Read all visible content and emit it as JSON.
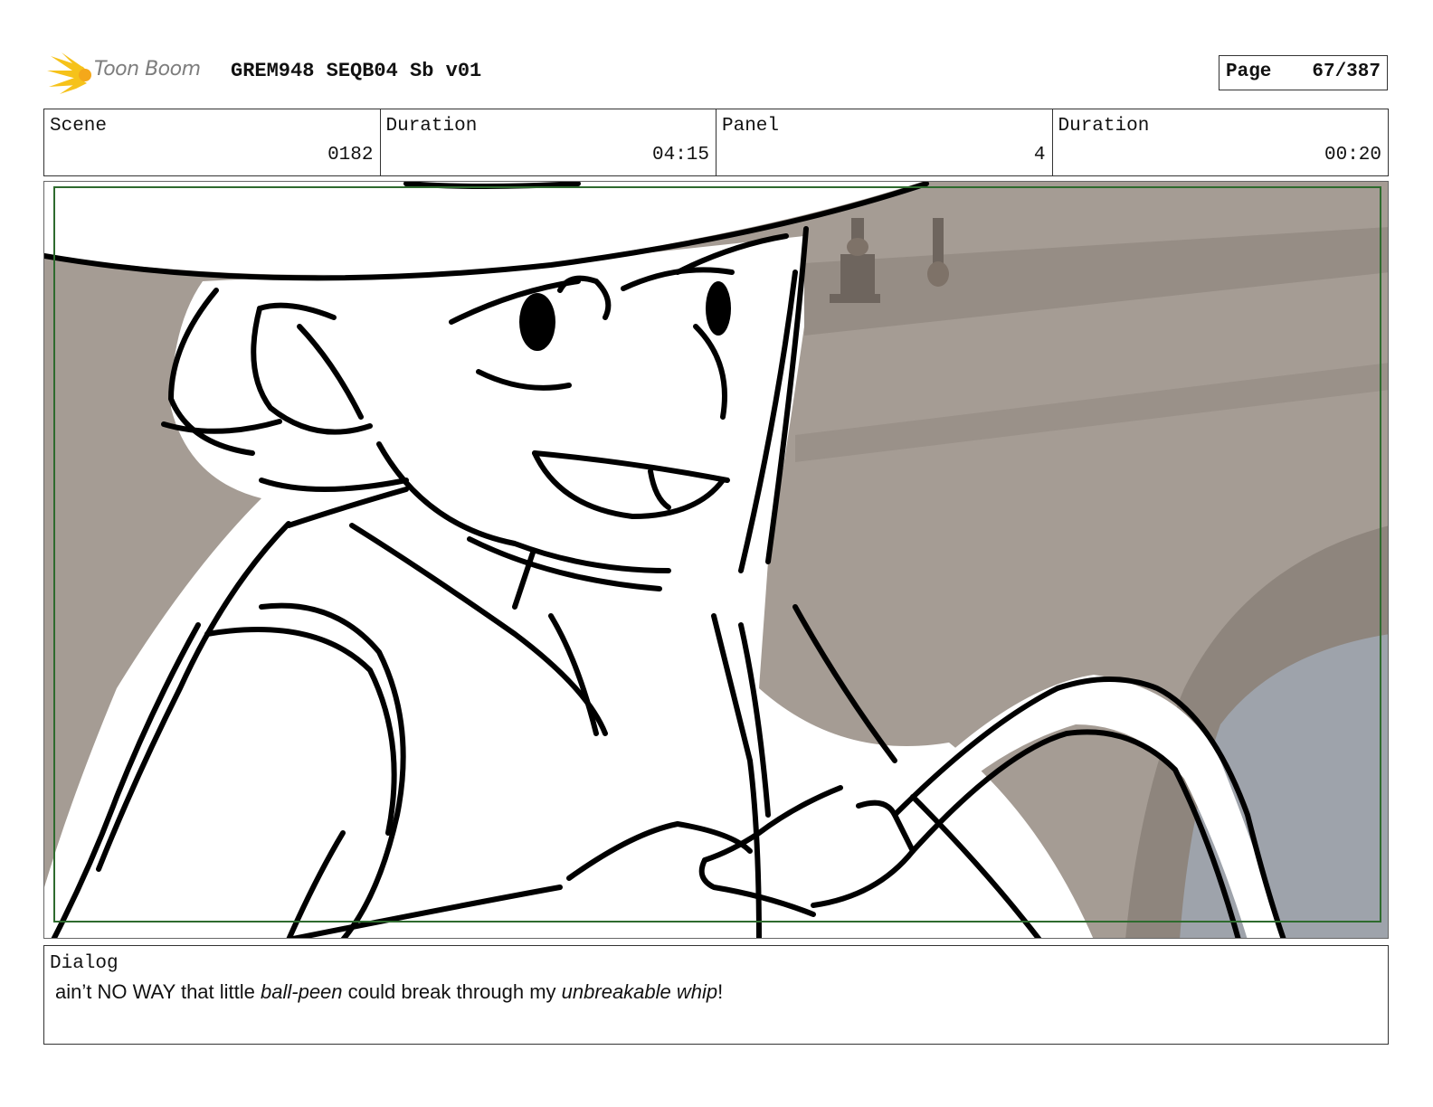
{
  "header": {
    "logo_text": "Toon Boom",
    "title": "GREM948 SEQB04 Sb v01",
    "page_label": "Page",
    "page_value": "67/387"
  },
  "info": {
    "scene_label": "Scene",
    "scene_value": "0182",
    "scene_duration_label": "Duration",
    "scene_duration_value": "04:15",
    "panel_label": "Panel",
    "panel_value": "4",
    "panel_duration_label": "Duration",
    "panel_duration_value": "00:20"
  },
  "dialog": {
    "label": "Dialog",
    "parts": {
      "p1": "ain’t NO WAY that little ",
      "p2": "ball-peen",
      "p3": " could break through my ",
      "p4": "unbreakable whip",
      "p5": "!"
    }
  },
  "colors": {
    "safe_frame": "#2e6b2e",
    "background_wall": "#a59c94",
    "background_dark": "#8e857d",
    "background_slate": "#9ea3ab",
    "ink": "#000000",
    "logo_yellow": "#f6c21a"
  }
}
